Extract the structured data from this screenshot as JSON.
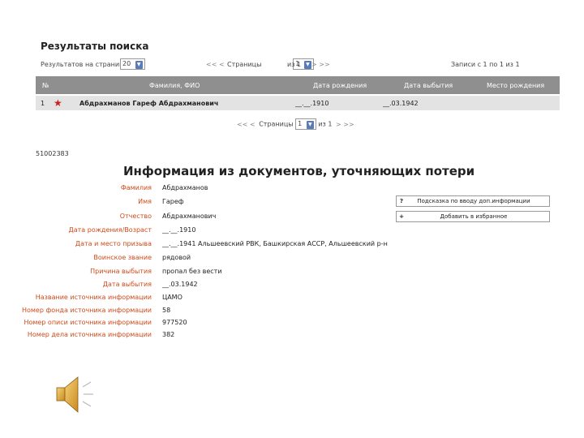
{
  "results": {
    "title": "Результаты поиска",
    "per_page_label": "Результатов на странице",
    "per_page_value": "20",
    "page_label": "Страницы",
    "page_value": "1",
    "page_of": "из 1",
    "records_label": "Записи с 1 по 1 из 1",
    "nav_prev": "<<  <",
    "nav_next": ">  >>"
  },
  "table": {
    "columns": [
      "№",
      "Фамилия, ФИО",
      "Дата рождения",
      "Дата выбытия",
      "Место рождения"
    ],
    "rows": [
      {
        "num": "1",
        "name": "Абдрахманов Гареф Абдрахманович",
        "birth": "__.__.1910",
        "exit": "__.03.1942",
        "place": ""
      }
    ]
  },
  "pager_bottom": {
    "nav_prev": "<<  <",
    "label": "Страницы",
    "value": "1",
    "of": "из 1",
    "nav_next": ">  >>"
  },
  "document": {
    "id": "51002383",
    "title": "Информация из документов, уточняющих потери",
    "fields": [
      {
        "label": "Фамилия",
        "value": "Абдрахманов"
      },
      {
        "label": "Имя",
        "value": "Гареф"
      },
      {
        "label": "Отчество",
        "value": "Абдрахманович"
      },
      {
        "label": "Дата рождения/Возраст",
        "value": "__.__.1910"
      },
      {
        "label": "Дата и место призыва",
        "value": "__.__.1941 Альшеевский РВК, Башкирская АССР, Альшеевский р-н"
      },
      {
        "label": "Воинское звание",
        "value": "рядовой"
      },
      {
        "label": "Причина выбытия",
        "value": "пропал без вести"
      },
      {
        "label": "Дата выбытия",
        "value": "__.03.1942"
      },
      {
        "label": "Название источника информации",
        "value": "ЦАМО"
      },
      {
        "label": "Номер фонда источника информации",
        "value": "58"
      },
      {
        "label": "Номер описи источника информации",
        "value": "977520"
      },
      {
        "label": "Номер дела источника информации",
        "value": "382"
      }
    ],
    "help_button": {
      "icon": "?",
      "label": "Подсказка по вводу доп.информации"
    },
    "fav_button": {
      "icon": "+",
      "label": "Добавить в избранное"
    }
  }
}
